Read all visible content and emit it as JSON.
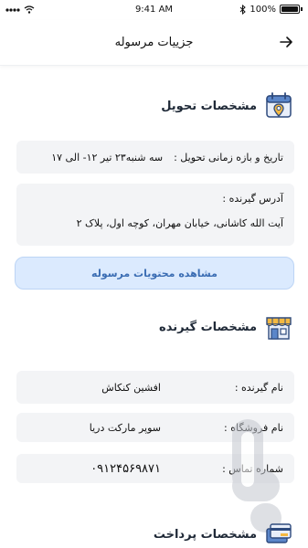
{
  "status_bar": {
    "time": "9:41 AM",
    "battery": "100%"
  },
  "header": {
    "title": "جزییات مرسوله"
  },
  "delivery": {
    "title": "مشخصات تحویل",
    "datetime_label": "تاریخ و بازه زمانی تحویل :",
    "datetime_value": "سه شنبه۲۳ تیر ۱۲- الی ۱۷",
    "address_label": "آدرس گیرنده :",
    "address_value": "آیت الله کاشانی، خیابان مهران، کوچه اول، پلاک ۲",
    "contents_button": "مشاهده محتویات مرسوله"
  },
  "recipient": {
    "title": "مشخصات گیرنده",
    "rows": [
      {
        "label": "نام گیرنده :",
        "value": "افشین کنکاش"
      },
      {
        "label": "نام فروشگاه :",
        "value": "سوپر مارکت دریا"
      },
      {
        "label": "شماره تماس :",
        "value": "۰۹۱۲۴۵۶۹۸۷۱"
      }
    ]
  },
  "payment": {
    "title": "مشخصات پرداخت"
  },
  "colors": {
    "accent": "#3b6db3",
    "card_bg": "#f3f4f6",
    "button_bg": "#dbeafe"
  },
  "icons": [
    "wifi-icon",
    "signal-icon",
    "bluetooth-icon",
    "battery-icon",
    "back-arrow-icon",
    "calendar-location-icon",
    "store-icon",
    "payment-card-icon"
  ]
}
